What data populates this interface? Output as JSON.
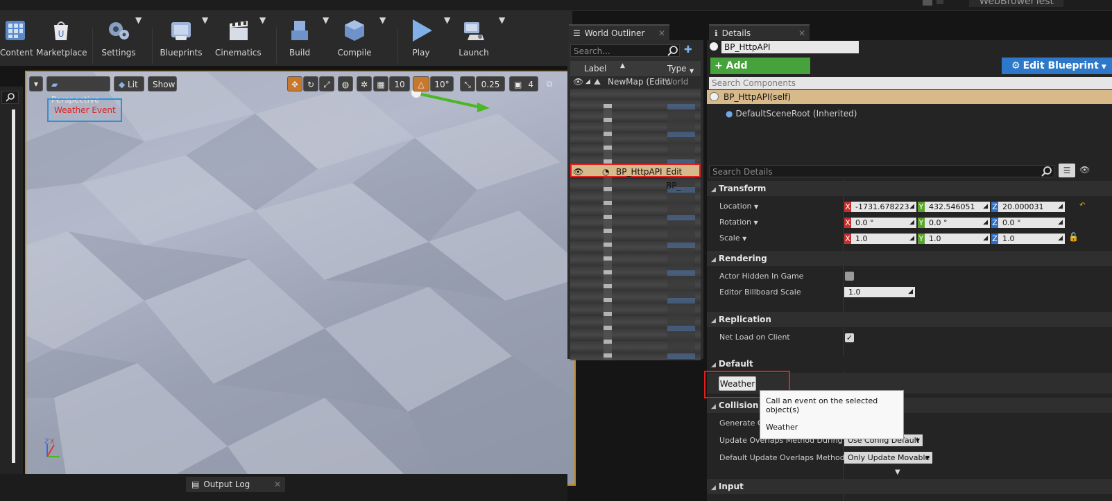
{
  "window": {
    "title": "WebBrowerTest"
  },
  "toolbar": {
    "items": [
      {
        "label": "Content",
        "icon": "content-icon"
      },
      {
        "label": "Marketplace",
        "icon": "marketplace-icon"
      },
      {
        "label": "Settings",
        "icon": "settings-icon"
      },
      {
        "label": "Blueprints",
        "icon": "blueprints-icon"
      },
      {
        "label": "Cinematics",
        "icon": "cinematics-icon"
      },
      {
        "label": "Build",
        "icon": "build-icon"
      },
      {
        "label": "Compile",
        "icon": "compile-icon"
      },
      {
        "label": "Play",
        "icon": "play-icon"
      },
      {
        "label": "Launch",
        "icon": "launch-icon"
      }
    ]
  },
  "viewport": {
    "perspective_label": "Perspective",
    "lit_label": "Lit",
    "show_label": "Show",
    "grid_snap": "10",
    "rot_snap": "10°",
    "scale_snap": "0.25",
    "cam_speed": "4",
    "annotation": "Weather Event"
  },
  "world_outliner": {
    "tab": "World Outliner",
    "search_placeholder": "Search...",
    "col_label": "Label",
    "col_type": "Type",
    "map_row": {
      "label": "NewMap (Edito",
      "type": "World"
    },
    "selected_row": {
      "label": "BP_HttpAPI",
      "type": "Edit BP_"
    }
  },
  "details": {
    "tab": "Details",
    "actor_name": "BP_HttpAPI",
    "add_component": "+ Add Component",
    "edit_blueprint": "Edit Blueprint",
    "search_components_placeholder": "Search Components",
    "self_component": "BP_HttpAPI(self)",
    "scene_root": "DefaultSceneRoot (Inherited)",
    "search_details_placeholder": "Search Details",
    "transform": {
      "header": "Transform",
      "location": {
        "label": "Location",
        "x": "-1731.678223",
        "y": "432.546051",
        "z": "20.000031"
      },
      "rotation": {
        "label": "Rotation",
        "x": "0.0 °",
        "y": "0.0 °",
        "z": "0.0 °"
      },
      "scale": {
        "label": "Scale",
        "x": "1.0",
        "y": "1.0",
        "z": "1.0"
      }
    },
    "rendering": {
      "header": "Rendering",
      "actor_hidden": "Actor Hidden In Game",
      "billboard_scale_label": "Editor Billboard Scale",
      "billboard_scale": "1.0"
    },
    "replication": {
      "header": "Replication",
      "net_load": "Net Load on Client"
    },
    "default": {
      "header": "Default",
      "weather_button": "Weather"
    },
    "tooltip": {
      "title": "Call an event on the selected object(s)",
      "item": "Weather"
    },
    "collision": {
      "header": "Collision",
      "generate_overlap": "Generate Ov",
      "update_overlaps_label": "Update Overlaps Method During Lev",
      "update_overlaps_value": "Use Config Default",
      "default_update_label": "Default Update Overlaps Method Du",
      "default_update_value": "Only Update Movable"
    },
    "input": {
      "header": "Input"
    }
  },
  "output_log": {
    "tab": "Output Log"
  },
  "colors": {
    "selection": "#d8b98a",
    "highlight_red": "#e41d1d",
    "annotation_blue": "#2f90d8",
    "add_component_green": "#46a23a",
    "edit_blueprint_blue": "#2d78c8"
  }
}
